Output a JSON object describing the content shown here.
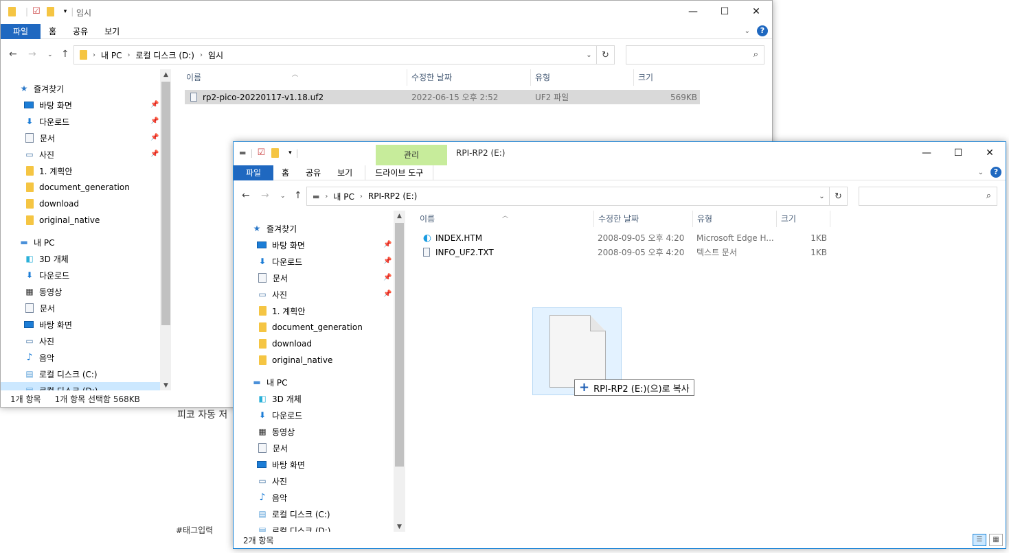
{
  "background": {
    "text1": "피코 자동 저",
    "text2": "#태그입력"
  },
  "win1": {
    "title": "임시",
    "tabs": [
      "파일",
      "홈",
      "공유",
      "보기"
    ],
    "address": [
      "내 PC",
      "로컬 디스크 (D:)",
      "임시"
    ],
    "nav": [
      {
        "label": "즐겨찾기"
      },
      {
        "label": "바탕 화면"
      },
      {
        "label": "다운로드"
      },
      {
        "label": "문서"
      },
      {
        "label": "사진"
      },
      {
        "label": "1. 계획안"
      },
      {
        "label": "document_generation"
      },
      {
        "label": "download"
      },
      {
        "label": "original_native"
      },
      {
        "label": "내 PC"
      },
      {
        "label": "3D 개체"
      },
      {
        "label": "다운로드"
      },
      {
        "label": "동영상"
      },
      {
        "label": "문서"
      },
      {
        "label": "바탕 화면"
      },
      {
        "label": "사진"
      },
      {
        "label": "음악"
      },
      {
        "label": "로컬 디스크 (C:)"
      },
      {
        "label": "로컬 디스크 (D:)"
      }
    ],
    "columns": [
      "이름",
      "수정한 날짜",
      "유형",
      "크기"
    ],
    "files": [
      {
        "name": "rp2-pico-20220117-v1.18.uf2",
        "date": "2022-06-15 오후 2:52",
        "type": "UF2 파일",
        "size": "569KB"
      }
    ],
    "status_count": "1개 항목",
    "status_selected": "1개 항목 선택함 568KB"
  },
  "win2": {
    "title": "RPI-RP2 (E:)",
    "context_group": "관리",
    "context_tab": "드라이브 도구",
    "tabs": [
      "파일",
      "홈",
      "공유",
      "보기"
    ],
    "address": [
      "내 PC",
      "RPI-RP2 (E:)"
    ],
    "nav": [
      {
        "label": "즐겨찾기"
      },
      {
        "label": "바탕 화면"
      },
      {
        "label": "다운로드"
      },
      {
        "label": "문서"
      },
      {
        "label": "사진"
      },
      {
        "label": "1. 계획안"
      },
      {
        "label": "document_generation"
      },
      {
        "label": "download"
      },
      {
        "label": "original_native"
      },
      {
        "label": "내 PC"
      },
      {
        "label": "3D 개체"
      },
      {
        "label": "다운로드"
      },
      {
        "label": "동영상"
      },
      {
        "label": "문서"
      },
      {
        "label": "바탕 화면"
      },
      {
        "label": "사진"
      },
      {
        "label": "음악"
      },
      {
        "label": "로컬 디스크 (C:)"
      },
      {
        "label": "로컬 디스크 (D:)"
      }
    ],
    "columns": [
      "이름",
      "수정한 날짜",
      "유형",
      "크기"
    ],
    "files": [
      {
        "name": "INDEX.HTM",
        "date": "2008-09-05 오후 4:20",
        "type": "Microsoft Edge H...",
        "size": "1KB"
      },
      {
        "name": "INFO_UF2.TXT",
        "date": "2008-09-05 오후 4:20",
        "type": "텍스트 문서",
        "size": "1KB"
      }
    ],
    "status_count": "2개 항목"
  },
  "drag": {
    "tooltip": "RPI-RP2 (E:)(으)로 복사"
  },
  "icons": {
    "minimize": "minimize-icon",
    "maximize": "maximize-icon",
    "close": "close-icon"
  }
}
